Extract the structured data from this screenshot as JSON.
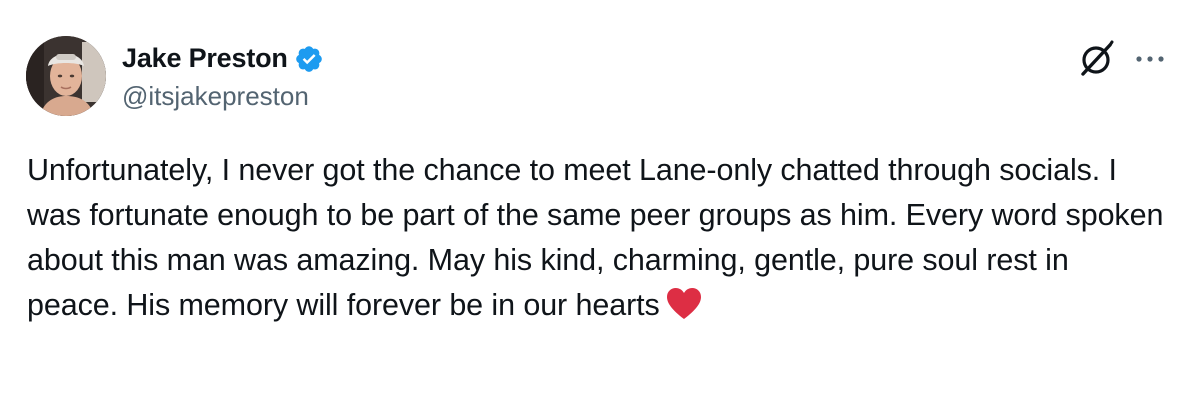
{
  "author": {
    "display_name": "Jake Preston",
    "handle": "@itsjakepreston",
    "verified": true,
    "avatar_icon": "profile-photo",
    "verified_color": "#1d9bf0"
  },
  "actions": {
    "grok_icon": "grok-icon",
    "more_icon": "more-icon"
  },
  "tweet": {
    "text": "Unfortunately, I never got the chance to meet Lane-only chatted through socials. I was fortunate enough to be part of the same peer groups as him. Every word spoken about this man was amazing. May his kind, charming, gentle, pure soul rest in peace. His memory will forever be in our hearts",
    "emoji_icon": "red-heart-emoji",
    "emoji_color": "#dd2e44"
  },
  "colors": {
    "text_primary": "#0f1419",
    "text_secondary": "#536471",
    "background": "#ffffff"
  }
}
